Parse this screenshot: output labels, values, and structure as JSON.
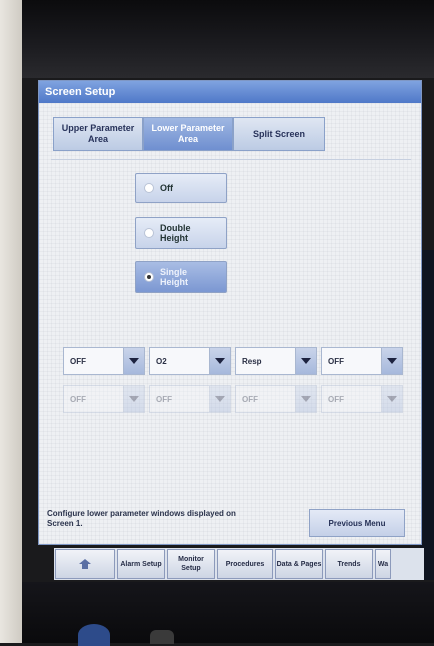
{
  "window": {
    "title": "Screen Setup"
  },
  "tabs": [
    {
      "label": "Upper Parameter Area",
      "active": false
    },
    {
      "label": "Lower Parameter Area",
      "active": true
    },
    {
      "label": "Split Screen",
      "active": false
    }
  ],
  "options": [
    {
      "label": "Off",
      "selected": false
    },
    {
      "label": "Double Height",
      "selected": false
    },
    {
      "label": "Single Height",
      "selected": true
    }
  ],
  "dropdowns_row1": [
    "OFF",
    "O2",
    "Resp",
    "OFF"
  ],
  "dropdowns_row2": [
    "OFF",
    "OFF",
    "OFF",
    "OFF"
  ],
  "footer": {
    "help_text": "Configure lower parameter windows displayed on Screen 1.",
    "previous_menu_label": "Previous Menu"
  },
  "bottom_nav": {
    "home_icon": "home-icon",
    "items": [
      "Alarm Setup",
      "Monitor Setup",
      "Procedures",
      "Data & Pages",
      "Trends",
      "Wa"
    ]
  },
  "colors": {
    "titlebar": "#5f86d0",
    "selected_tab": "#6f8fd0",
    "window_bg": "#eef0f3"
  }
}
